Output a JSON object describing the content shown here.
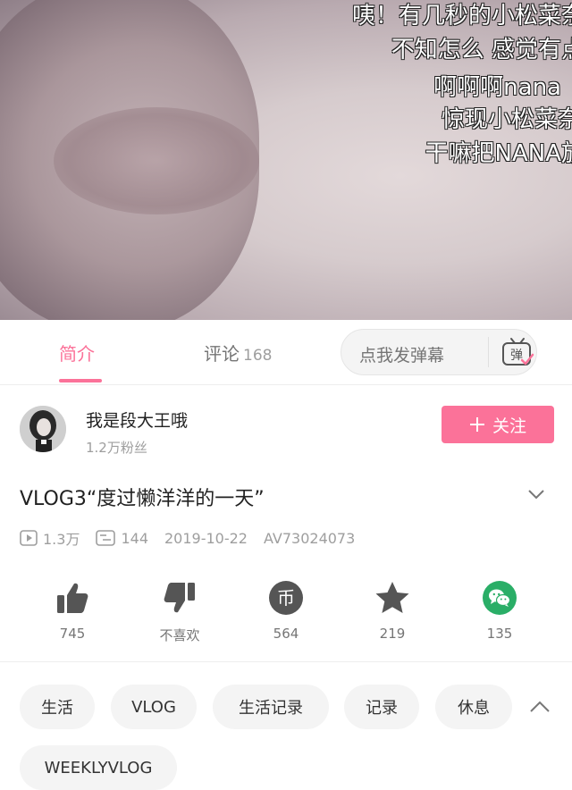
{
  "video": {
    "danmaku": [
      "咦！有几秒的小松菜奈也",
      "不知怎么 感觉有点淡",
      "啊啊啊nana",
      "惊现小松菜奈",
      "干嘛把NANA放"
    ]
  },
  "tabs": {
    "intro": "简介",
    "comments": "评论",
    "comment_count": "168",
    "danmaku_placeholder": "点我发弹幕",
    "danmaku_icon_text": "弹"
  },
  "uploader": {
    "name": "我是段大王哦",
    "fans": "1.2万粉丝",
    "follow_label": "关注",
    "follow_icon": "plus-icon"
  },
  "video_info": {
    "title": "VLOG3“度过懒洋洋的一天”",
    "views": "1.3万",
    "danmaku_count": "144",
    "date": "2019-10-22",
    "av_id": "AV73024073"
  },
  "actions": {
    "like": "745",
    "dislike": "不喜欢",
    "coin": "564",
    "favorite": "219",
    "share": "135",
    "coin_glyph": "币"
  },
  "tags": [
    "生活",
    "VLOG",
    "生活记录",
    "记录",
    "休息",
    "WEEKLYVLOG"
  ],
  "colors": {
    "accent": "#fb7299",
    "icon_gray": "#555555",
    "wechat": "#2aae67"
  }
}
